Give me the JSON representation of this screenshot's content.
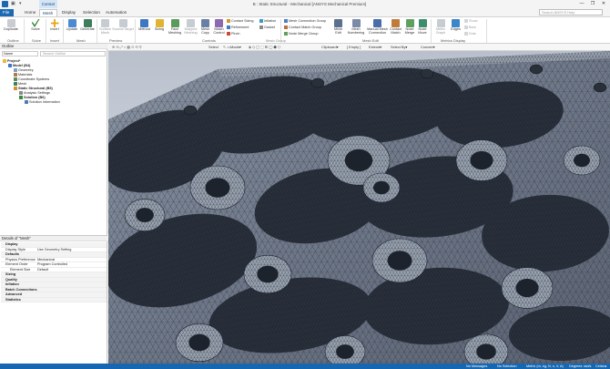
{
  "window": {
    "title": "B : Static Structural - Mechanical [ANSYS Mechanical Premium]",
    "context_label": "Context",
    "controls": [
      "—",
      "❐",
      "✕"
    ]
  },
  "tabs": [
    "File",
    "Home",
    "Mesh",
    "Display",
    "Selection",
    "Automation"
  ],
  "search": {
    "placeholder": "Search ANSYS Help"
  },
  "ribbon": {
    "outline": {
      "group": "Outline",
      "duplicate": "Duplicate"
    },
    "solve": {
      "group": "Solve",
      "label": "Solve"
    },
    "insert": {
      "group": "Insert",
      "label": "Insert"
    },
    "mesh": {
      "group": "Mesh",
      "update": "Update",
      "generate": "Generate"
    },
    "preview": {
      "group": "Preview",
      "surface_mesh": "Surface Mesh",
      "source_target": "Source/Target"
    },
    "controls": {
      "group": "Controls",
      "method": "Method",
      "sizing": "Sizing",
      "face_meshing": "Face Meshing",
      "mapped_meshing": "Mapped Meshing",
      "mesh_copy": "Mesh Copy",
      "match_control": "Match Control",
      "contact_sizing": "Contact Sizing",
      "refinement": "Refinement",
      "pinch": "Pinch",
      "inflation": "Inflation",
      "gasket": "Gasket"
    },
    "mesh_group": {
      "label": "Mesh Group"
    },
    "mesh_edit": {
      "group": "Mesh Edit",
      "connection_group": "Mesh Connection Group",
      "contact_match_group": "Contact Match Group",
      "node_merge_group": "Node Merge Group",
      "mesh_edit": "Mesh Edit",
      "mesh_numbering": "Mesh Numbering",
      "manual_connection": "Manual Mesh Connection",
      "contact_match": "Contact Match",
      "node_merge": "Node Merge",
      "node_move": "Node Move"
    },
    "metrics": {
      "group": "Metrics Display",
      "metric_graph": "Metric Graph",
      "edges": "Edges",
      "show": "Show",
      "bars": "Bars",
      "dots": "Dots"
    }
  },
  "outline": {
    "title": "Outline",
    "filter_label": "Name",
    "search_placeholder": "Search Outline",
    "tree": [
      "Project*",
      "Model (B4)",
      "Geometry",
      "Materials",
      "Coordinate Systems",
      "Mesh",
      "Static Structural (B5)",
      "Analysis Settings",
      "Solution (B6)",
      "Solution Information"
    ]
  },
  "details": {
    "title": "Details of \"Mesh\"",
    "sections": {
      "display": "Display",
      "defaults": "Defaults",
      "sizing": "Sizing",
      "quality": "Quality",
      "inflation": "Inflation",
      "batch": "Batch Connections",
      "advanced": "Advanced",
      "statistics": "Statistics"
    },
    "rows": {
      "display_style_k": "Display Style",
      "display_style_v": "Use Geometry Setting",
      "physics_k": "Physics Preference",
      "physics_v": "Mechanical",
      "order_k": "Element Order",
      "order_v": "Program Controlled",
      "size_k": "Element Size",
      "size_v": "Default"
    }
  },
  "toolbar": {
    "select": "Select",
    "mode": "Mode▾",
    "clipboard": "Clipboard▾",
    "empty": "[ Empty ]",
    "extend": "Extend▾",
    "select_by": "Select By▾",
    "convert": "Convert▾"
  },
  "status": {
    "messages": "No Messages",
    "selection": "No Selection",
    "units": "Metric (m, kg, N, s, V, A)",
    "angle": "Degrees",
    "rate": "rad/s",
    "temp": "Celsius"
  },
  "colors": {
    "brand": "#1a69b3",
    "status_bar": "#1567b1",
    "mesh_face": "#7b8594",
    "mesh_line": "#1b2230"
  }
}
